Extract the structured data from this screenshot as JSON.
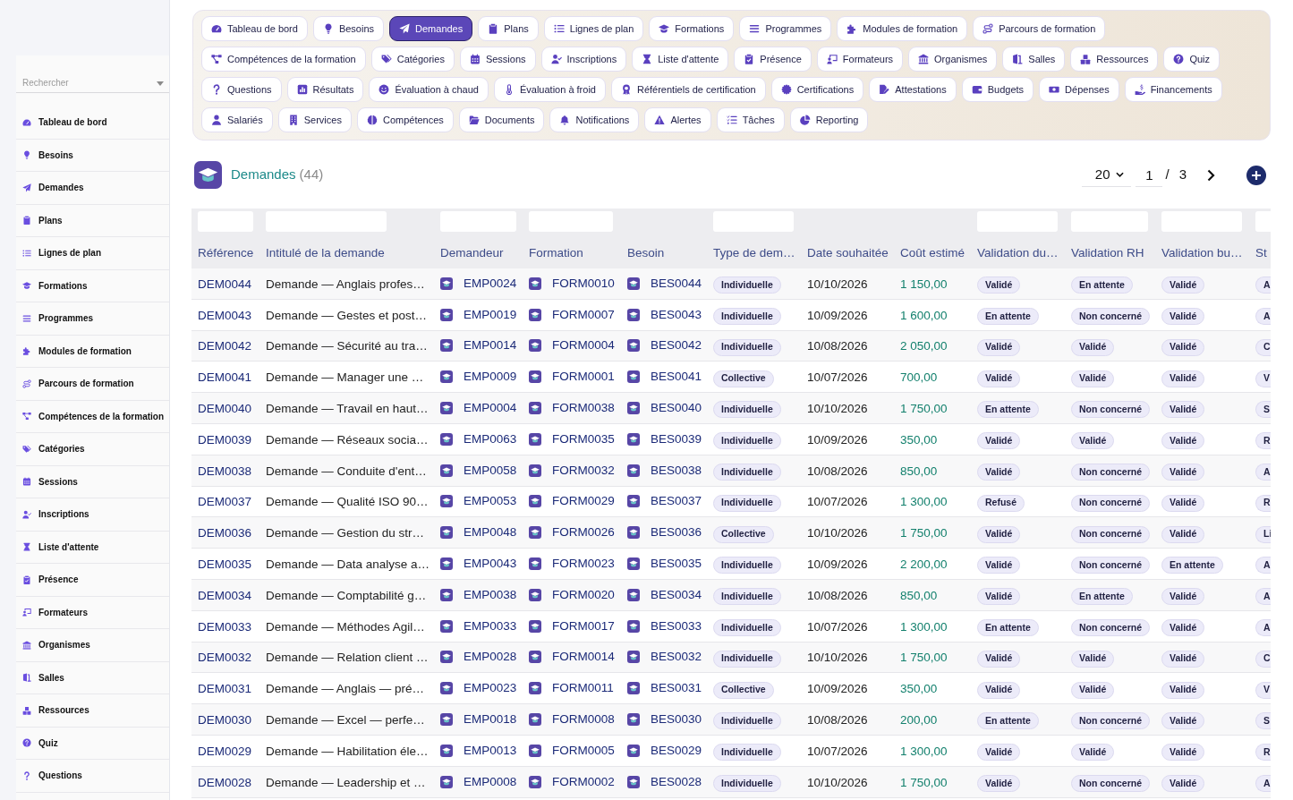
{
  "sidebar": {
    "search": {
      "placeholder": "Rechercher"
    },
    "items": [
      "Tableau de bord",
      "Besoins",
      "Demandes",
      "Plans",
      "Lignes de plan",
      "Formations",
      "Programmes",
      "Modules de formation",
      "Parcours de formation",
      "Compétences de la formation",
      "Catégories",
      "Sessions",
      "Inscriptions",
      "Liste d'attente",
      "Présence",
      "Formateurs",
      "Organismes",
      "Salles",
      "Ressources",
      "Quiz",
      "Questions"
    ]
  },
  "nav": {
    "tabs": [
      {
        "label": "Tableau de bord",
        "selected": false
      },
      {
        "label": "Besoins",
        "selected": false
      },
      {
        "label": "Demandes",
        "selected": true
      },
      {
        "label": "Plans",
        "selected": false
      },
      {
        "label": "Lignes de plan",
        "selected": false
      },
      {
        "label": "Formations",
        "selected": false
      },
      {
        "label": "Programmes",
        "selected": false
      },
      {
        "label": "Modules de formation",
        "selected": false
      },
      {
        "label": "Parcours de formation",
        "selected": false
      },
      {
        "label": "Compétences de la formation",
        "selected": false
      },
      {
        "label": "Catégories",
        "selected": false
      },
      {
        "label": "Sessions",
        "selected": false
      },
      {
        "label": "Inscriptions",
        "selected": false
      },
      {
        "label": "Liste d'attente",
        "selected": false
      },
      {
        "label": "Présence",
        "selected": false
      },
      {
        "label": "Formateurs",
        "selected": false
      },
      {
        "label": "Organismes",
        "selected": false
      },
      {
        "label": "Salles",
        "selected": false
      },
      {
        "label": "Ressources",
        "selected": false
      },
      {
        "label": "Quiz",
        "selected": false
      },
      {
        "label": "Questions",
        "selected": false
      },
      {
        "label": "Résultats",
        "selected": false
      },
      {
        "label": "Évaluation à chaud",
        "selected": false
      },
      {
        "label": "Évaluation à froid",
        "selected": false
      },
      {
        "label": "Référentiels de certification",
        "selected": false
      },
      {
        "label": "Certifications",
        "selected": false
      },
      {
        "label": "Attestations",
        "selected": false
      },
      {
        "label": "Budgets",
        "selected": false
      },
      {
        "label": "Dépenses",
        "selected": false
      },
      {
        "label": "Financements",
        "selected": false
      },
      {
        "label": "Salariés",
        "selected": false
      },
      {
        "label": "Services",
        "selected": false
      },
      {
        "label": "Compétences",
        "selected": false
      },
      {
        "label": "Documents",
        "selected": false
      },
      {
        "label": "Notifications",
        "selected": false
      },
      {
        "label": "Alertes",
        "selected": false
      },
      {
        "label": "Tâches",
        "selected": false
      },
      {
        "label": "Reporting",
        "selected": false
      }
    ]
  },
  "header": {
    "title": "Demandes",
    "count": "(44)"
  },
  "pagination": {
    "page_size": "20",
    "page": "1",
    "separator": "/",
    "total_pages": "3"
  },
  "table": {
    "columns": [
      {
        "label": "Référence",
        "kind": "link",
        "filter": true
      },
      {
        "label": "Intitulé de la demande",
        "kind": "text",
        "filter": true
      },
      {
        "label": "Demandeur",
        "kind": "icon_link",
        "filter": true
      },
      {
        "label": "Formation",
        "kind": "icon_link",
        "filter": true
      },
      {
        "label": "Besoin",
        "kind": "icon_link",
        "filter": false
      },
      {
        "label": "Type de dem…",
        "kind": "tag",
        "filter": true
      },
      {
        "label": "Date souhaitée",
        "kind": "text",
        "filter": false
      },
      {
        "label": "Coût estimé",
        "kind": "amount",
        "filter": false
      },
      {
        "label": "Validation du…",
        "kind": "tag",
        "filter": true
      },
      {
        "label": "Validation RH",
        "kind": "tag",
        "filter": true
      },
      {
        "label": "Validation bu…",
        "kind": "tag",
        "filter": true
      },
      {
        "label": "St",
        "kind": "tag",
        "filter": true
      }
    ],
    "rows": [
      {
        "cells": [
          "DEM0044",
          "Demande — Anglais profes…",
          "EMP0024",
          "FORM0010",
          "BES0044",
          "Individuelle",
          "10/10/2026",
          "1 150,00",
          "Validé",
          "En attente",
          "Validé",
          "A"
        ]
      },
      {
        "cells": [
          "DEM0043",
          "Demande — Gestes et post…",
          "EMP0019",
          "FORM0007",
          "BES0043",
          "Individuelle",
          "10/09/2026",
          "1 600,00",
          "En attente",
          "Non concerné",
          "Validé",
          "A"
        ]
      },
      {
        "cells": [
          "DEM0042",
          "Demande — Sécurité au tra…",
          "EMP0014",
          "FORM0004",
          "BES0042",
          "Individuelle",
          "10/08/2026",
          "2 050,00",
          "Validé",
          "Validé",
          "Validé",
          "C"
        ]
      },
      {
        "cells": [
          "DEM0041",
          "Demande — Manager une …",
          "EMP0009",
          "FORM0001",
          "BES0041",
          "Collective",
          "10/07/2026",
          "700,00",
          "Validé",
          "Validé",
          "Validé",
          "V"
        ]
      },
      {
        "cells": [
          "DEM0040",
          "Demande — Travail en haut…",
          "EMP0004",
          "FORM0038",
          "BES0040",
          "Individuelle",
          "10/10/2026",
          "1 750,00",
          "En attente",
          "Non concerné",
          "Validé",
          "S"
        ]
      },
      {
        "cells": [
          "DEM0039",
          "Demande — Réseaux socia…",
          "EMP0063",
          "FORM0035",
          "BES0039",
          "Individuelle",
          "10/09/2026",
          "350,00",
          "Validé",
          "Validé",
          "Validé",
          "R"
        ]
      },
      {
        "cells": [
          "DEM0038",
          "Demande — Conduite d'ent…",
          "EMP0058",
          "FORM0032",
          "BES0038",
          "Individuelle",
          "10/08/2026",
          "850,00",
          "Validé",
          "Non concerné",
          "Validé",
          "A"
        ]
      },
      {
        "cells": [
          "DEM0037",
          "Demande — Qualité ISO 90…",
          "EMP0053",
          "FORM0029",
          "BES0037",
          "Individuelle",
          "10/07/2026",
          "1 300,00",
          "Refusé",
          "Non concerné",
          "Validé",
          "R"
        ]
      },
      {
        "cells": [
          "DEM0036",
          "Demande — Gestion du str…",
          "EMP0048",
          "FORM0026",
          "BES0036",
          "Collective",
          "10/10/2026",
          "1 750,00",
          "Validé",
          "Non concerné",
          "Validé",
          "Li"
        ]
      },
      {
        "cells": [
          "DEM0035",
          "Demande — Data analyse a…",
          "EMP0043",
          "FORM0023",
          "BES0035",
          "Individuelle",
          "10/09/2026",
          "2 200,00",
          "Validé",
          "Non concerné",
          "En attente",
          "A"
        ]
      },
      {
        "cells": [
          "DEM0034",
          "Demande — Comptabilité g…",
          "EMP0038",
          "FORM0020",
          "BES0034",
          "Individuelle",
          "10/08/2026",
          "850,00",
          "Validé",
          "En attente",
          "Validé",
          "A"
        ]
      },
      {
        "cells": [
          "DEM0033",
          "Demande — Méthodes Agil…",
          "EMP0033",
          "FORM0017",
          "BES0033",
          "Individuelle",
          "10/07/2026",
          "1 300,00",
          "En attente",
          "Non concerné",
          "Validé",
          "A"
        ]
      },
      {
        "cells": [
          "DEM0032",
          "Demande — Relation client …",
          "EMP0028",
          "FORM0014",
          "BES0032",
          "Individuelle",
          "10/10/2026",
          "1 750,00",
          "Validé",
          "Validé",
          "Validé",
          "C"
        ]
      },
      {
        "cells": [
          "DEM0031",
          "Demande — Anglais — pré…",
          "EMP0023",
          "FORM0011",
          "BES0031",
          "Collective",
          "10/09/2026",
          "350,00",
          "Validé",
          "Validé",
          "Validé",
          "V"
        ]
      },
      {
        "cells": [
          "DEM0030",
          "Demande — Excel — perfe…",
          "EMP0018",
          "FORM0008",
          "BES0030",
          "Individuelle",
          "10/08/2026",
          "200,00",
          "En attente",
          "Non concerné",
          "Validé",
          "S"
        ]
      },
      {
        "cells": [
          "DEM0029",
          "Demande — Habilitation éle…",
          "EMP0013",
          "FORM0005",
          "BES0029",
          "Individuelle",
          "10/07/2026",
          "1 300,00",
          "Validé",
          "Validé",
          "Validé",
          "R"
        ]
      },
      {
        "cells": [
          "DEM0028",
          "Demande — Leadership et …",
          "EMP0008",
          "FORM0002",
          "BES0028",
          "Individuelle",
          "10/10/2026",
          "1 750,00",
          "Validé",
          "Non concerné",
          "Validé",
          "A"
        ]
      }
    ]
  }
}
